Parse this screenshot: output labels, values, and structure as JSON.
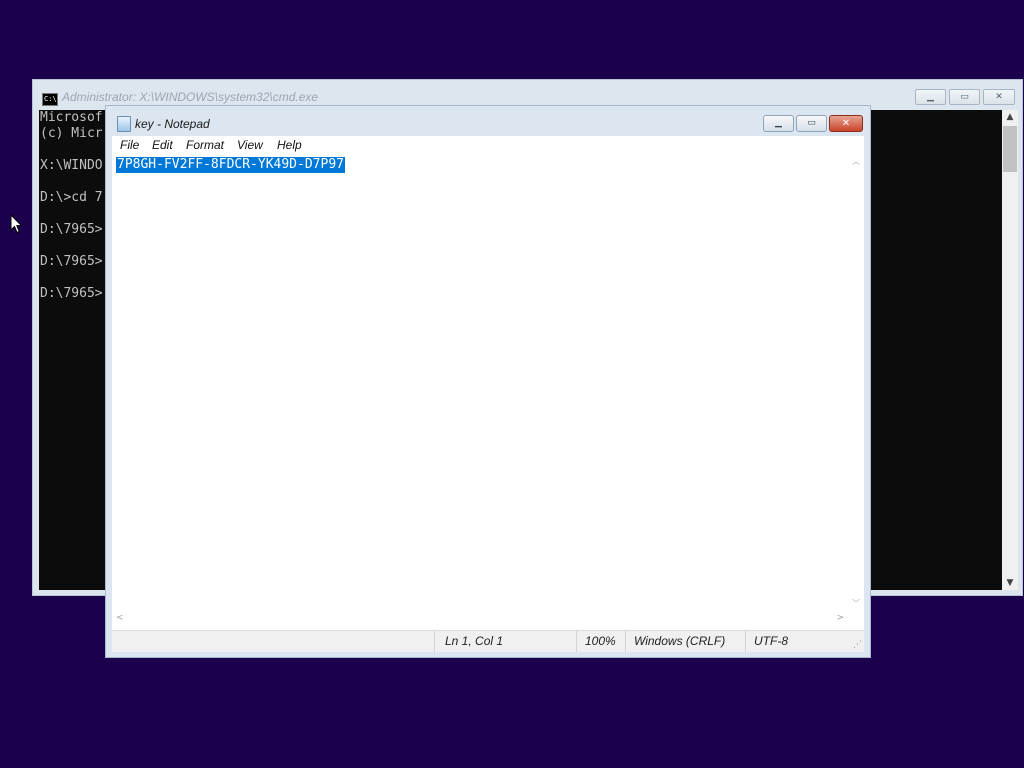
{
  "cmd": {
    "title": "Administrator: X:\\WINDOWS\\system32\\cmd.exe",
    "icon_text": "C:\\",
    "lines": [
      "Microsof",
      "(c) Micr",
      "",
      "X:\\WINDO",
      "",
      "D:\\>cd 7",
      "",
      "D:\\7965>",
      "",
      "D:\\7965>",
      "",
      "D:\\7965>"
    ]
  },
  "notepad": {
    "title": "key - Notepad",
    "menu": [
      "File",
      "Edit",
      "Format",
      "View",
      "Help"
    ],
    "content": "7P8GH-FV2FF-8FDCR-YK49D-D7P97",
    "status": {
      "position": "Ln 1, Col 1",
      "zoom": "100%",
      "line_ending": "Windows (CRLF)",
      "encoding": "UTF-8"
    }
  },
  "colors": {
    "desktop": "#1b004d",
    "selection": "#0078d7",
    "console_bg": "#0c0c0c"
  },
  "icons": {
    "minimize": "minimize-icon",
    "maximize": "maximize-icon",
    "close": "close-icon",
    "cursor": "mouse-pointer-icon"
  }
}
